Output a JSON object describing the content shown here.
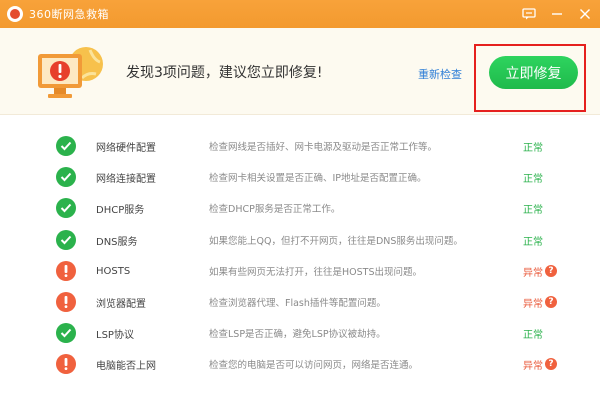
{
  "window": {
    "title": "360断网急救箱"
  },
  "header": {
    "problem_text": "发现3项问题，建议您立即修复!",
    "rescan_label": "重新检查",
    "fix_label": "立即修复"
  },
  "items": [
    {
      "name": "网络硬件配置",
      "desc": "检查网线是否插好、网卡电源及驱动是否正常工作等。",
      "status": "正常",
      "ok": true
    },
    {
      "name": "网络连接配置",
      "desc": "检查网卡相关设置是否正确、IP地址是否配置正确。",
      "status": "正常",
      "ok": true
    },
    {
      "name": "DHCP服务",
      "desc": "检查DHCP服务是否正常工作。",
      "status": "正常",
      "ok": true
    },
    {
      "name": "DNS服务",
      "desc": "如果您能上QQ，但打不开网页，往往是DNS服务出现问题。",
      "status": "正常",
      "ok": true
    },
    {
      "name": "HOSTS",
      "desc": "如果有些网页无法打开，往往是HOSTS出现问题。",
      "status": "异常",
      "ok": false
    },
    {
      "name": "浏览器配置",
      "desc": "检查浏览器代理、Flash插件等配置问题。",
      "status": "异常",
      "ok": false
    },
    {
      "name": "LSP协议",
      "desc": "检查LSP是否正确，避免LSP协议被劫持。",
      "status": "正常",
      "ok": true
    },
    {
      "name": "电脑能否上网",
      "desc": "检查您的电脑是否可以访问网页，网络是否连通。",
      "status": "异常",
      "ok": false
    }
  ],
  "colors": {
    "titlebar": "#f39a2f",
    "ok": "#2bb24c",
    "error": "#f0613e",
    "accent_button": "#1fba4b",
    "highlight": "#e5201e"
  }
}
